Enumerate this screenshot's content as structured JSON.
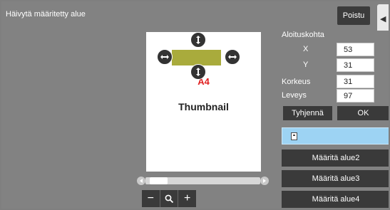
{
  "header": {
    "title": "Häivytä määritetty alue",
    "close_label": "Poistu"
  },
  "preview": {
    "page_size_label": "A4",
    "page_content_label": "Thumbnail"
  },
  "zoom": {
    "out": "−",
    "in": "+"
  },
  "panel": {
    "start_label": "Aloituskohta",
    "x_label": "X",
    "x_value": "53",
    "y_label": "Y",
    "y_value": "31",
    "height_label": "Korkeus",
    "height_value": "31",
    "width_label": "Leveys",
    "width_value": "97",
    "clear_label": "Tyhjennä",
    "ok_label": "OK",
    "area_buttons": [
      "Määritä alue2",
      "Määritä alue3",
      "Määritä alue4"
    ]
  }
}
